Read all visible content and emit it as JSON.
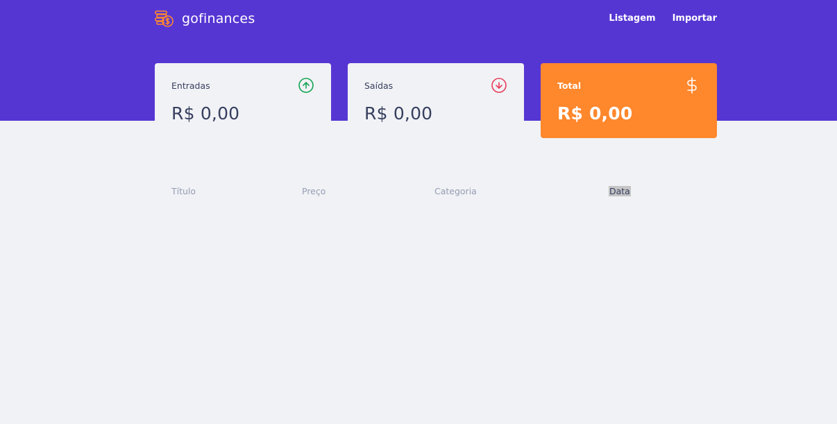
{
  "app": {
    "logo_text": "gofinances"
  },
  "nav": {
    "items": [
      {
        "label": "Listagem"
      },
      {
        "label": "Importar"
      }
    ]
  },
  "cards": {
    "income": {
      "label": "Entradas",
      "value": "R$ 0,00",
      "icon": "arrow-up-circle-icon",
      "icon_color": "#12a454"
    },
    "outcome": {
      "label": "Saídas",
      "value": "R$ 0,00",
      "icon": "arrow-down-circle-icon",
      "icon_color": "#e83f5b"
    },
    "total": {
      "label": "Total",
      "value": "R$ 0,00",
      "icon": "dollar-sign-icon",
      "background": "#ff872c"
    }
  },
  "table": {
    "headers": [
      "Título",
      "Preço",
      "Categoria",
      "Data"
    ]
  },
  "colors": {
    "header_bg": "#5636d3",
    "page_bg": "#f0f2f5",
    "text_primary": "#363f5f",
    "text_muted": "#969cb3"
  }
}
